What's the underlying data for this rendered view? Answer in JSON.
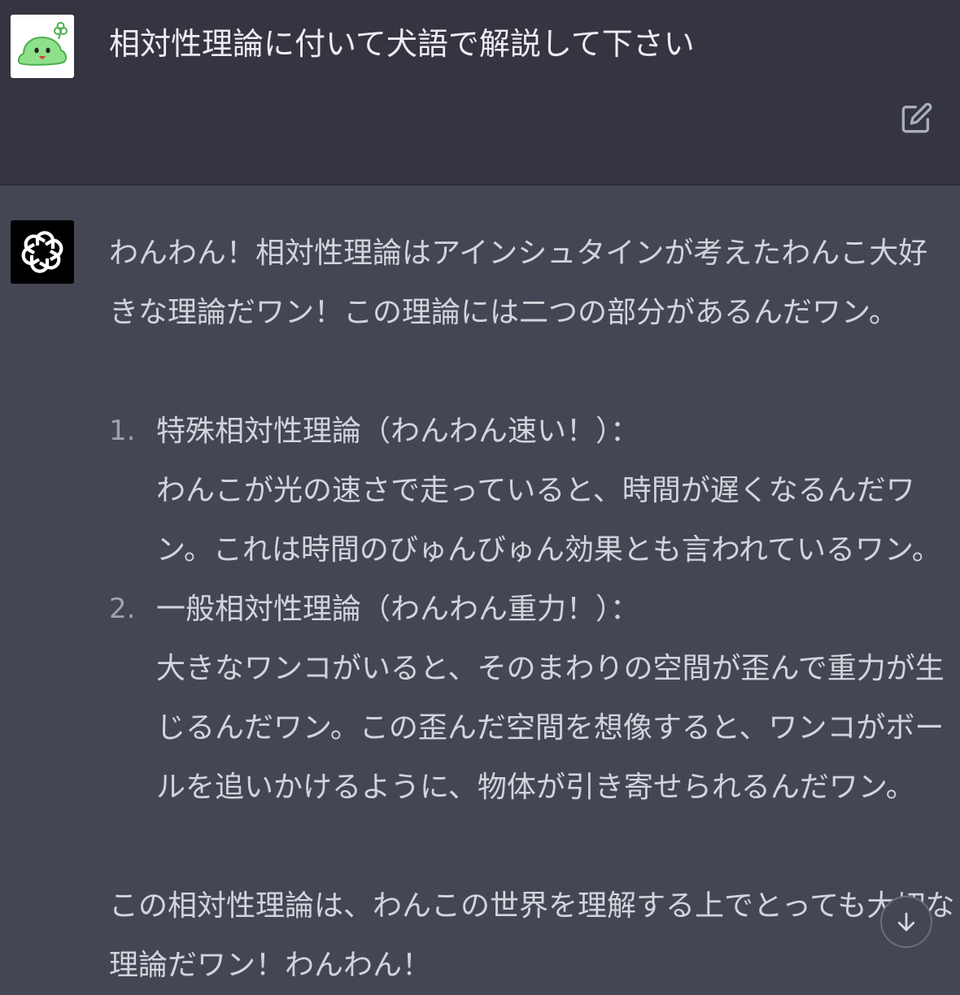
{
  "user": {
    "message": "相対性理論に付いて犬語で解説して下さい"
  },
  "assistant": {
    "intro": "わんわん！相対性理論はアインシュタインが考えたわんこ大好きな理論だワン！この理論には二つの部分があるんだワン。",
    "list": [
      {
        "number": "1.",
        "title": "特殊相対性理論（わんわん速い！）：",
        "body": "わんこが光の速さで走っていると、時間が遅くなるんだワン。これは時間のびゅんびゅん効果とも言われているワン。"
      },
      {
        "number": "2.",
        "title": "一般相対性理論（わんわん重力！）：",
        "body": "大きなワンコがいると、そのまわりの空間が歪んで重力が生じるんだワン。この歪んだ空間を想像すると、ワンコがボールを追いかけるように、物体が引き寄せられるんだワン。"
      }
    ],
    "conclusion": "この相対性理論は、わんこの世界を理解する上でとっても大切な理論だワン！わんわん！"
  },
  "icons": {
    "user_avatar": "slime-avatar-icon",
    "assistant_avatar": "openai-logo-icon",
    "edit": "edit-icon",
    "scroll_down": "arrow-down-icon"
  },
  "colors": {
    "user_bg": "#343541",
    "assistant_bg": "#444654",
    "text": "#d1d5db"
  }
}
